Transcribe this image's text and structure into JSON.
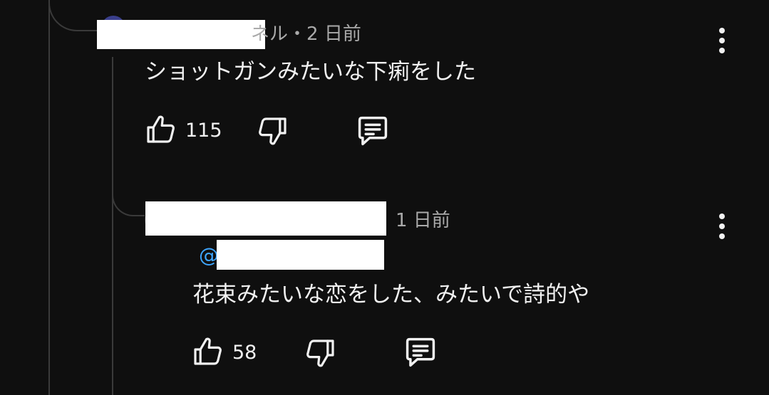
{
  "comment": {
    "author_partial": "ネル",
    "separator": "・",
    "timestamp": "2 日前",
    "text": "ショットガンみたいな下痢をした",
    "likes": "115"
  },
  "reply": {
    "timestamp": "1 日前",
    "mention_prefix": "@",
    "text": "花束みたいな恋をした、みたいで詩的や",
    "likes": "58"
  },
  "icons": {
    "like": "thumbs-up-icon",
    "dislike": "thumbs-down-icon",
    "reply": "reply-comment-icon",
    "menu": "more-vertical-icon"
  },
  "colors": {
    "background": "#0f0f0f",
    "text": "#f1f1f1",
    "meta": "#aaaaaa",
    "mention": "#3ea6ff",
    "thread_line": "#3a3a3a"
  }
}
